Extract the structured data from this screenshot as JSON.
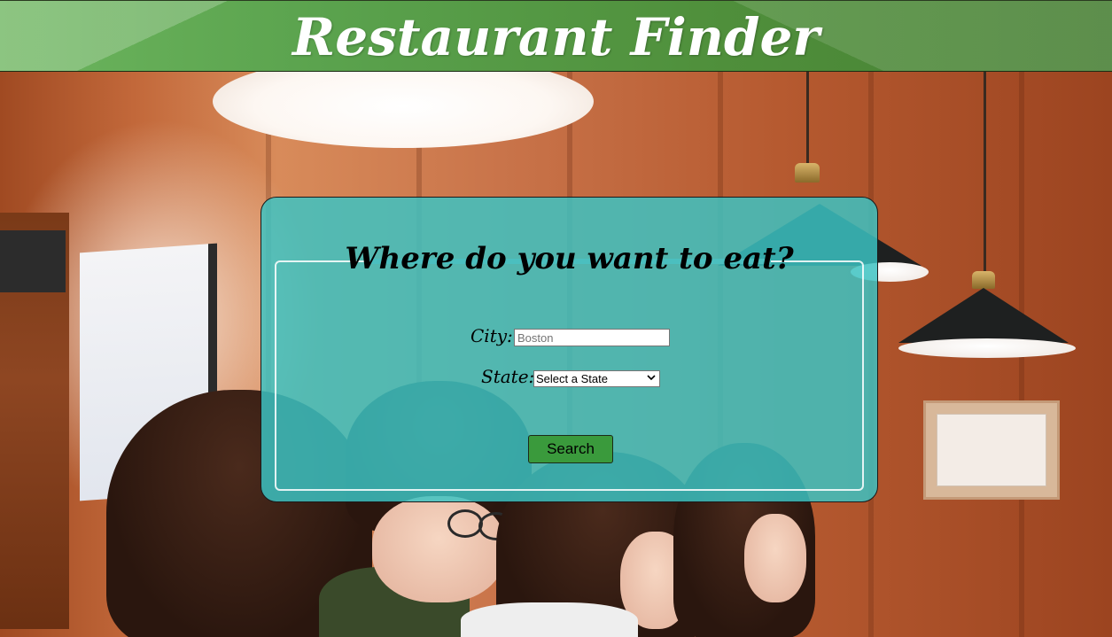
{
  "header": {
    "title": "Restaurant Finder"
  },
  "search_panel": {
    "title": "Where do you want to eat?",
    "city_label": "City:",
    "city_placeholder": "Boston",
    "city_value": "",
    "state_label": "State:",
    "state_selected": "Select a State",
    "search_button_label": "Search"
  },
  "colors": {
    "header_green": "#5aa24d",
    "panel_teal": "#3cc4c4",
    "button_green": "#3a9a3c",
    "title_text": "#ffffff"
  },
  "icons": {
    "select_arrow": "chevron-down-icon"
  }
}
